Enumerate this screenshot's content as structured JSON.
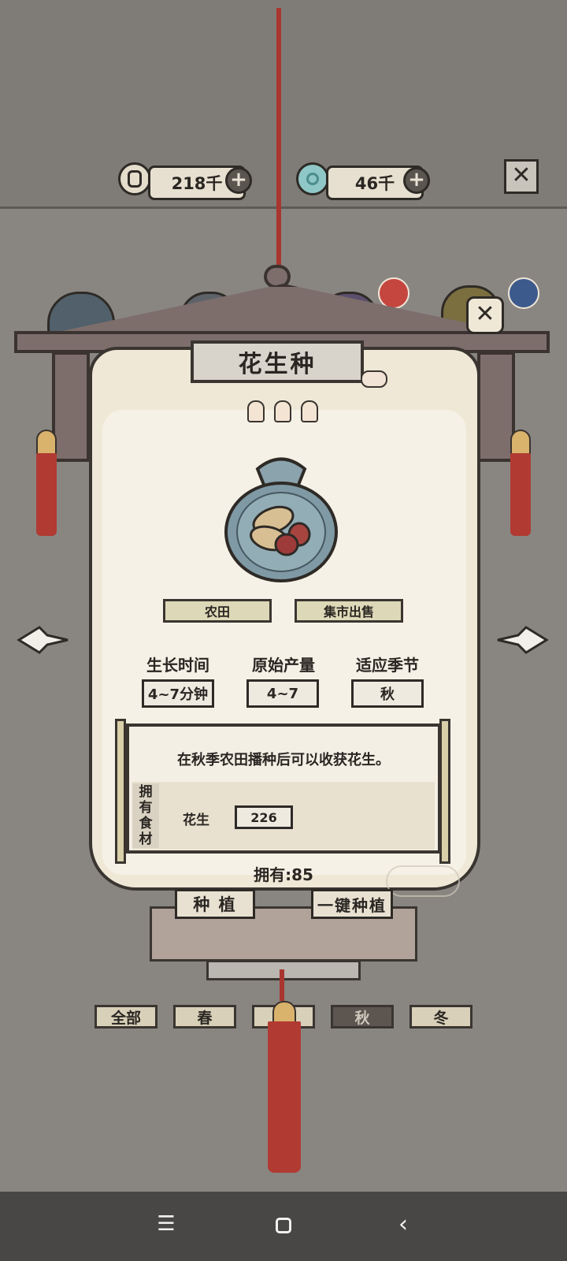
{
  "currency": {
    "coins": "218千",
    "jade": "46千"
  },
  "item": {
    "title": "花生种",
    "stars": 3,
    "tags": [
      "农田",
      "集市出售"
    ],
    "stats": [
      {
        "label": "生长时间",
        "value": "4~7分钟"
      },
      {
        "label": "原始产量",
        "value": "4~7"
      },
      {
        "label": "适应季节",
        "value": "秋"
      }
    ],
    "description": "在秋季农田播种后可以收获花生。",
    "ingredients_label": [
      "拥",
      "有",
      "食",
      "材"
    ],
    "ingredient": {
      "name": "花生",
      "count": "226"
    },
    "owned": "拥有:85"
  },
  "actions": {
    "plant": "种 植",
    "plant_all": "一键种植"
  },
  "season_tabs": [
    "全部",
    "春",
    "",
    "秋",
    "冬"
  ],
  "active_season": "秋",
  "icons": {
    "coin": "coin-icon",
    "jade": "jade-icon",
    "close": "close-icon",
    "prev": "arrow-left-icon",
    "next": "arrow-right-icon",
    "seed_bag": "seed-bag-icon"
  }
}
